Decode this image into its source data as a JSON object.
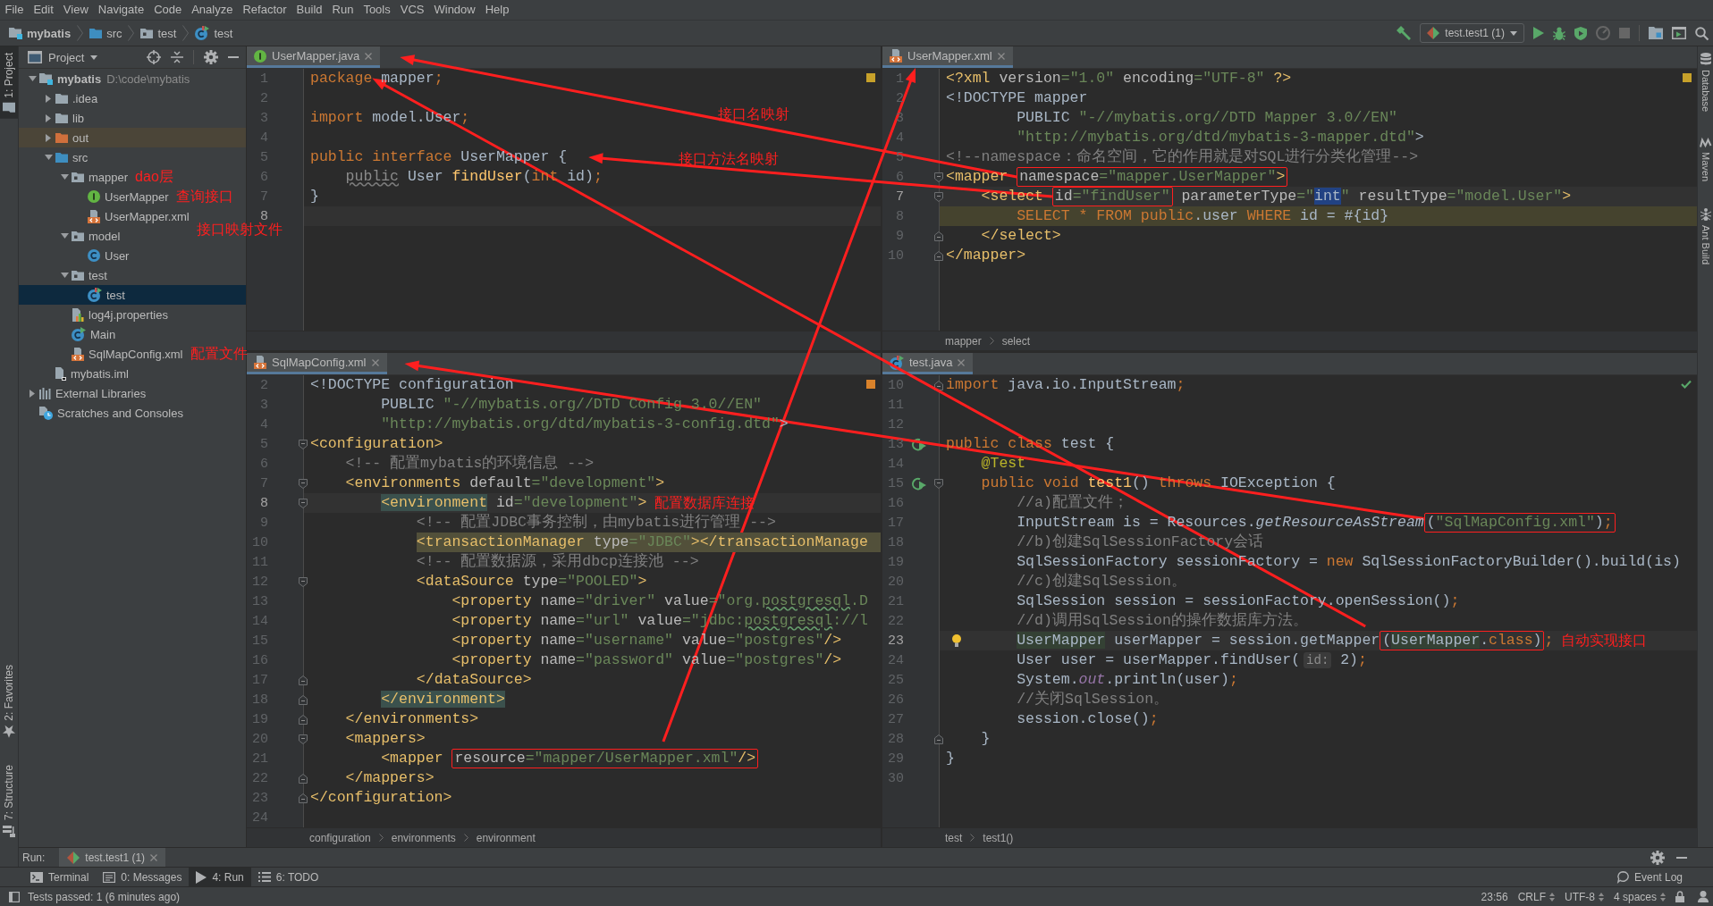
{
  "menu": [
    "File",
    "Edit",
    "View",
    "Navigate",
    "Code",
    "Analyze",
    "Refactor",
    "Build",
    "Run",
    "Tools",
    "VCS",
    "Window",
    "Help"
  ],
  "navigation": {
    "crumbs": [
      {
        "label": "mybatis",
        "kind": "module"
      },
      {
        "label": "src",
        "kind": "source-folder"
      },
      {
        "label": "test",
        "kind": "package"
      },
      {
        "label": "test",
        "kind": "test-class"
      }
    ],
    "toolbar": [
      {
        "kind": "build",
        "disabled": false
      },
      {
        "kind": "config",
        "label": "test.test1 (1)",
        "disabled": false
      },
      {
        "kind": "run",
        "disabled": false
      },
      {
        "kind": "debug",
        "disabled": false
      },
      {
        "kind": "coverage",
        "disabled": false
      },
      {
        "kind": "profile",
        "disabled": true
      },
      {
        "kind": "stop",
        "disabled": true
      },
      {
        "kind": "structure",
        "disabled": false
      },
      {
        "kind": "run-window",
        "disabled": false
      },
      {
        "kind": "search",
        "disabled": false
      }
    ]
  },
  "left_strip": {
    "top": [
      {
        "label": "1: Project",
        "kind": "project",
        "selected": true
      }
    ],
    "bottom": [
      {
        "label": "2: Favorites",
        "kind": "favorites",
        "selected": false
      },
      {
        "label": "7: Structure",
        "kind": "structure",
        "selected": false
      }
    ]
  },
  "project": {
    "title": "Project",
    "tree": [
      {
        "label": "mybatis",
        "path": "D:\\code\\mybatis",
        "kind": "module",
        "expanded": true,
        "selected": false,
        "children": [
          {
            "label": ".idea",
            "kind": "folder",
            "expanded": false,
            "selected": false
          },
          {
            "label": "lib",
            "kind": "folder",
            "expanded": false,
            "selected": false
          },
          {
            "label": "out",
            "kind": "excluded-folder",
            "expanded": false,
            "selected": false
          },
          {
            "label": "src",
            "kind": "source-folder",
            "expanded": true,
            "selected": false,
            "children": [
              {
                "label": "mapper",
                "kind": "package",
                "expanded": true,
                "selected": false,
                "note": "dao层",
                "children": [
                  {
                    "label": "UserMapper",
                    "kind": "interface",
                    "selected": false,
                    "note": "查询接口"
                  },
                  {
                    "label": "UserMapper.xml",
                    "kind": "xml",
                    "selected": false,
                    "note": "接口映射文件"
                  }
                ]
              },
              {
                "label": "model",
                "kind": "package",
                "expanded": true,
                "selected": false,
                "children": [
                  {
                    "label": "User",
                    "kind": "class",
                    "selected": false
                  }
                ]
              },
              {
                "label": "test",
                "kind": "package",
                "expanded": true,
                "selected": false,
                "children": [
                  {
                    "label": "test",
                    "kind": "test-class",
                    "selected": true
                  }
                ]
              },
              {
                "label": "log4j.properties",
                "kind": "properties",
                "selected": false
              },
              {
                "label": "Main",
                "kind": "main-class",
                "selected": false
              },
              {
                "label": "SqlMapConfig.xml",
                "kind": "xml",
                "selected": false,
                "note": "配置文件"
              }
            ]
          },
          {
            "label": "mybatis.iml",
            "kind": "iml",
            "selected": false
          }
        ]
      },
      {
        "label": "External Libraries",
        "kind": "libraries",
        "expanded": false,
        "selected": false
      },
      {
        "label": "Scratches and Consoles",
        "kind": "scratches",
        "selected": false
      }
    ]
  },
  "editors": [
    {
      "tab": {
        "label": "UserMapper.java",
        "kind": "interface",
        "selected": true
      },
      "inspection": {
        "kind": "warning"
      },
      "annotations": [
        "接口名映射",
        "接口方法名映射"
      ],
      "lines": [
        {
          "number": "1",
          "current": false,
          "tokens": [
            {
              "kind": "kw",
              "text": "package"
            },
            {
              "kind": "plain",
              "text": " mapper"
            },
            {
              "kind": "kw",
              "text": ";"
            }
          ]
        },
        {
          "number": "2",
          "current": false
        },
        {
          "number": "3",
          "current": false,
          "tokens": [
            {
              "kind": "kw",
              "text": "import"
            },
            {
              "kind": "plain",
              "text": " model.User"
            },
            {
              "kind": "kw",
              "text": ";"
            }
          ]
        },
        {
          "number": "4",
          "current": false
        },
        {
          "number": "5",
          "current": false,
          "tokens": [
            {
              "kind": "kw",
              "text": "public interface"
            },
            {
              "kind": "plain",
              "text": " UserMapper {"
            }
          ]
        },
        {
          "number": "6",
          "current": false,
          "tokens": [
            {
              "kind": "unused",
              "text": "    public"
            },
            {
              "kind": "plain",
              "text": " User "
            },
            {
              "kind": "method",
              "text": "findUser"
            },
            {
              "kind": "plain",
              "text": "("
            },
            {
              "kind": "kw",
              "text": "int"
            },
            {
              "kind": "plain",
              "text": " id)"
            },
            {
              "kind": "kw",
              "text": ";"
            }
          ]
        },
        {
          "number": "7",
          "current": false,
          "tokens": [
            {
              "kind": "plain",
              "text": "}"
            }
          ]
        },
        {
          "number": "8",
          "current": true
        }
      ]
    },
    {
      "tab": {
        "label": "UserMapper.xml",
        "kind": "xml",
        "selected": true
      },
      "inspection": {
        "kind": "warning"
      },
      "breadcrumbs": [
        "mapper",
        "select"
      ],
      "lines": [
        {
          "number": "1",
          "current": false,
          "injected": false,
          "tokens": [
            {
              "kind": "tag",
              "text": "<?xml"
            },
            {
              "kind": "attr",
              "text": " version"
            },
            {
              "kind": "string",
              "text": "=\"1.0\""
            },
            {
              "kind": "attr",
              "text": " encoding"
            },
            {
              "kind": "string",
              "text": "=\"UTF-8\""
            },
            {
              "kind": "tag",
              "text": " ?>"
            }
          ]
        },
        {
          "number": "2",
          "current": false,
          "injected": false,
          "tokens": [
            {
              "kind": "plain",
              "text": "<!DOCTYPE mapper"
            }
          ]
        },
        {
          "number": "3",
          "current": false,
          "injected": false,
          "tokens": [
            {
              "kind": "plain",
              "text": "        PUBLIC "
            },
            {
              "kind": "string",
              "text": "\"-//mybatis.org//DTD Mapper 3.0//EN\""
            }
          ]
        },
        {
          "number": "4",
          "current": false,
          "injected": false,
          "tokens": [
            {
              "kind": "string",
              "text": "        \"http://mybatis.org/dtd/mybatis-3-mapper.dtd\""
            },
            {
              "kind": "plain",
              "text": ">"
            }
          ]
        },
        {
          "number": "5",
          "current": false,
          "injected": false,
          "tokens": [
            {
              "kind": "comment",
              "text": "<!--namespace：命名空间，它的作用就是对SQL进行分类化管理-->"
            }
          ]
        },
        {
          "number": "6",
          "current": false,
          "injected": false,
          "markers": [
            {
              "kind": "fold"
            }
          ],
          "tokens": [
            {
              "kind": "tag",
              "text": "<mapper "
            },
            {
              "kind": "frame",
              "tokens": [
                {
                  "kind": "attr",
                  "text": "namespace"
                },
                {
                  "kind": "string",
                  "text": "=\"mapper.UserMapper\""
                },
                {
                  "kind": "tag",
                  "text": ">"
                }
              ]
            }
          ]
        },
        {
          "number": "7",
          "current": true,
          "injected": false,
          "markers": [
            {
              "kind": "fold"
            }
          ],
          "tokens": [
            {
              "kind": "tag",
              "text": "    <select "
            },
            {
              "kind": "frame",
              "tokens": [
                {
                  "kind": "attr",
                  "text": "id"
                },
                {
                  "kind": "string",
                  "text": "=\"findUser\""
                }
              ]
            },
            {
              "kind": "attr",
              "text": " parameterType"
            },
            {
              "kind": "string",
              "text": "=\""
            },
            {
              "kind": "selection",
              "text": "int"
            },
            {
              "kind": "string",
              "text": "\""
            },
            {
              "kind": "attr",
              "text": " resultType"
            },
            {
              "kind": "string",
              "text": "=\"model.User\""
            },
            {
              "kind": "tag",
              "text": ">"
            }
          ]
        },
        {
          "number": "8",
          "current": false,
          "injected": true,
          "tokens": [
            {
              "kind": "kw",
              "text": "        SELECT * FROM public"
            },
            {
              "kind": "plain",
              "text": ".user "
            },
            {
              "kind": "kw",
              "text": "WHERE"
            },
            {
              "kind": "plain",
              "text": " id = #{id}"
            }
          ]
        },
        {
          "number": "9",
          "current": false,
          "injected": false,
          "markers": [
            {
              "kind": "fold-end"
            }
          ],
          "tokens": [
            {
              "kind": "tag",
              "text": "    </select>"
            }
          ]
        },
        {
          "number": "10",
          "current": false,
          "injected": false,
          "markers": [
            {
              "kind": "fold-end"
            }
          ],
          "tokens": [
            {
              "kind": "tag",
              "text": "</mapper>"
            }
          ]
        }
      ]
    },
    {
      "tab": {
        "label": "SqlMapConfig.xml",
        "kind": "xml",
        "selected": true
      },
      "inspection": {
        "kind": "problem"
      },
      "breadcrumbs": [
        "configuration",
        "environments",
        "environment"
      ],
      "lines": [
        {
          "number": "2",
          "current": false,
          "warning": false,
          "tokens": [
            {
              "kind": "plain",
              "text": "<!DOCTYPE configuration"
            }
          ]
        },
        {
          "number": "3",
          "current": false,
          "warning": false,
          "tokens": [
            {
              "kind": "plain",
              "text": "        PUBLIC "
            },
            {
              "kind": "string",
              "text": "\"-//mybatis.org//DTD Config 3.0//EN\""
            }
          ]
        },
        {
          "number": "4",
          "current": false,
          "warning": false,
          "tokens": [
            {
              "kind": "string",
              "text": "        \"http://mybatis.org/dtd/mybatis-3-config.dtd\""
            },
            {
              "kind": "plain",
              "text": ">"
            }
          ]
        },
        {
          "number": "5",
          "current": false,
          "warning": false,
          "markers": [
            {
              "kind": "fold"
            }
          ],
          "tokens": [
            {
              "kind": "tag",
              "text": "<configuration>"
            }
          ]
        },
        {
          "number": "6",
          "current": false,
          "warning": false,
          "tokens": [
            {
              "kind": "comment",
              "text": "    <!-- 配置mybatis的环境信息 -->"
            }
          ]
        },
        {
          "number": "7",
          "current": false,
          "warning": false,
          "markers": [
            {
              "kind": "fold"
            }
          ],
          "tokens": [
            {
              "kind": "tag",
              "text": "    <environments"
            },
            {
              "kind": "attr",
              "text": " default"
            },
            {
              "kind": "string",
              "text": "=\"development\""
            },
            {
              "kind": "tag",
              "text": ">"
            }
          ]
        },
        {
          "number": "8",
          "current": true,
          "warning": false,
          "markers": [
            {
              "kind": "fold"
            }
          ],
          "note": "配置数据库连接",
          "tokens": [
            {
              "kind": "match",
              "text": "        <environment"
            },
            {
              "kind": "attr",
              "text": " id"
            },
            {
              "kind": "string",
              "text": "=\"development\""
            },
            {
              "kind": "tag",
              "text": ">"
            }
          ]
        },
        {
          "number": "9",
          "current": false,
          "warning": false,
          "tokens": [
            {
              "kind": "comment",
              "text": "            <!-- 配置JDBC事务控制，由mybatis进行管理 -->"
            }
          ]
        },
        {
          "number": "10",
          "current": false,
          "warning": true,
          "tokens": [
            {
              "kind": "tag",
              "text": "            <transactionManager"
            },
            {
              "kind": "attr",
              "text": " type"
            },
            {
              "kind": "string",
              "text": "=\"JDBC\""
            },
            {
              "kind": "tag",
              "text": "></transactionManage"
            }
          ]
        },
        {
          "number": "11",
          "current": false,
          "warning": false,
          "tokens": [
            {
              "kind": "comment",
              "text": "            <!-- 配置数据源，采用dbcp连接池 -->"
            }
          ]
        },
        {
          "number": "12",
          "current": false,
          "warning": false,
          "markers": [
            {
              "kind": "fold"
            }
          ],
          "tokens": [
            {
              "kind": "tag",
              "text": "            <dataSource"
            },
            {
              "kind": "attr",
              "text": " type"
            },
            {
              "kind": "string",
              "text": "=\"POOLED\""
            },
            {
              "kind": "tag",
              "text": ">"
            }
          ]
        },
        {
          "number": "13",
          "current": false,
          "warning": false,
          "tokens": [
            {
              "kind": "tag",
              "text": "                <property"
            },
            {
              "kind": "attr",
              "text": " name"
            },
            {
              "kind": "string",
              "text": "=\"driver\""
            },
            {
              "kind": "attr",
              "text": " value"
            },
            {
              "kind": "string",
              "text": "=\"org."
            },
            {
              "kind": "typo",
              "text": "postgresql"
            },
            {
              "kind": "string",
              "text": ".D"
            }
          ]
        },
        {
          "number": "14",
          "current": false,
          "warning": false,
          "tokens": [
            {
              "kind": "tag",
              "text": "                <property"
            },
            {
              "kind": "attr",
              "text": " name"
            },
            {
              "kind": "string",
              "text": "=\"url\""
            },
            {
              "kind": "attr",
              "text": " value"
            },
            {
              "kind": "string",
              "text": "=\"jdbc:"
            },
            {
              "kind": "typo",
              "text": "postgresql"
            },
            {
              "kind": "string",
              "text": "://l"
            }
          ]
        },
        {
          "number": "15",
          "current": false,
          "warning": false,
          "tokens": [
            {
              "kind": "tag",
              "text": "                <property"
            },
            {
              "kind": "attr",
              "text": " name"
            },
            {
              "kind": "string",
              "text": "=\"username\""
            },
            {
              "kind": "attr",
              "text": " value"
            },
            {
              "kind": "string",
              "text": "=\"postgres\""
            },
            {
              "kind": "tag",
              "text": "/>"
            }
          ]
        },
        {
          "number": "16",
          "current": false,
          "warning": false,
          "tokens": [
            {
              "kind": "tag",
              "text": "                <property"
            },
            {
              "kind": "attr",
              "text": " name"
            },
            {
              "kind": "string",
              "text": "=\"password\""
            },
            {
              "kind": "attr",
              "text": " value"
            },
            {
              "kind": "string",
              "text": "=\"postgres\""
            },
            {
              "kind": "tag",
              "text": "/>"
            }
          ]
        },
        {
          "number": "17",
          "current": false,
          "warning": false,
          "markers": [
            {
              "kind": "fold-end"
            }
          ],
          "tokens": [
            {
              "kind": "tag",
              "text": "            </dataSource>"
            }
          ]
        },
        {
          "number": "18",
          "current": false,
          "warning": false,
          "markers": [
            {
              "kind": "fold-end"
            }
          ],
          "tokens": [
            {
              "kind": "match",
              "text": "        </environment>"
            }
          ]
        },
        {
          "number": "19",
          "current": false,
          "warning": false,
          "markers": [
            {
              "kind": "fold-end"
            }
          ],
          "tokens": [
            {
              "kind": "tag",
              "text": "    </environments>"
            }
          ]
        },
        {
          "number": "20",
          "current": false,
          "warning": false,
          "markers": [
            {
              "kind": "fold"
            }
          ],
          "tokens": [
            {
              "kind": "tag",
              "text": "    <mappers>"
            }
          ]
        },
        {
          "number": "21",
          "current": false,
          "warning": false,
          "tokens": [
            {
              "kind": "tag",
              "text": "        <mapper "
            },
            {
              "kind": "frame",
              "tokens": [
                {
                  "kind": "attr",
                  "text": "resource"
                },
                {
                  "kind": "string",
                  "text": "=\"mapper/UserMapper.xml\""
                },
                {
                  "kind": "tag",
                  "text": "/>"
                }
              ]
            }
          ]
        },
        {
          "number": "22",
          "current": false,
          "warning": false,
          "markers": [
            {
              "kind": "fold-end"
            }
          ],
          "tokens": [
            {
              "kind": "tag",
              "text": "    </mappers>"
            }
          ]
        },
        {
          "number": "23",
          "current": false,
          "warning": false,
          "markers": [
            {
              "kind": "fold-end"
            }
          ],
          "tokens": [
            {
              "kind": "tag",
              "text": "</configuration>"
            }
          ]
        },
        {
          "number": "24",
          "current": false,
          "warning": false
        }
      ]
    },
    {
      "tab": {
        "label": "test.java",
        "kind": "test-class",
        "selected": true
      },
      "inspection": {
        "kind": "ok"
      },
      "breadcrumbs": [
        "test",
        "test1()"
      ],
      "lines": [
        {
          "number": "10",
          "current": false,
          "markers": [
            {
              "kind": "fold-end"
            }
          ],
          "tokens": [
            {
              "kind": "kw",
              "text": "import"
            },
            {
              "kind": "plain",
              "text": " java.io.InputStream"
            },
            {
              "kind": "kw",
              "text": ";"
            }
          ]
        },
        {
          "number": "11",
          "current": false
        },
        {
          "number": "12",
          "current": false
        },
        {
          "number": "13",
          "current": false,
          "markers": [
            {
              "kind": "run"
            }
          ],
          "tokens": [
            {
              "kind": "kw",
              "text": "public class"
            },
            {
              "kind": "plain",
              "text": " test {"
            }
          ]
        },
        {
          "number": "14",
          "current": false,
          "tokens": [
            {
              "kind": "annotation",
              "text": "    @Test"
            }
          ]
        },
        {
          "number": "15",
          "current": false,
          "markers": [
            {
              "kind": "run"
            },
            {
              "kind": "fold"
            }
          ],
          "tokens": [
            {
              "kind": "kw",
              "text": "    public void "
            },
            {
              "kind": "method",
              "text": "test1"
            },
            {
              "kind": "plain",
              "text": "() "
            },
            {
              "kind": "kw",
              "text": "throws"
            },
            {
              "kind": "plain",
              "text": " IOException {"
            }
          ]
        },
        {
          "number": "16",
          "current": false,
          "tokens": [
            {
              "kind": "comment",
              "text": "        //a)配置文件；"
            }
          ]
        },
        {
          "number": "17",
          "current": false,
          "tokens": [
            {
              "kind": "plain",
              "text": "        InputStream is = Resources."
            },
            {
              "kind": "italic",
              "text": "getResourceAsStream"
            },
            {
              "kind": "frame",
              "tokens": [
                {
                  "kind": "plain",
                  "text": "("
                },
                {
                  "kind": "string",
                  "text": "\"SqlMapConfig.xml\""
                },
                {
                  "kind": "plain",
                  "text": ")"
                },
                {
                  "kind": "kw",
                  "text": ";"
                }
              ]
            }
          ]
        },
        {
          "number": "18",
          "current": false,
          "tokens": [
            {
              "kind": "comment",
              "text": "        //b)创建SqlSessionFactory会话"
            }
          ]
        },
        {
          "number": "19",
          "current": false,
          "tokens": [
            {
              "kind": "plain",
              "text": "        SqlSessionFactory sessionFactory = "
            },
            {
              "kind": "kw",
              "text": "new"
            },
            {
              "kind": "plain",
              "text": " SqlSessionFactoryBuilder().build(is)"
            }
          ]
        },
        {
          "number": "20",
          "current": false,
          "tokens": [
            {
              "kind": "comment",
              "text": "        //c)创建SqlSession。"
            }
          ]
        },
        {
          "number": "21",
          "current": false,
          "tokens": [
            {
              "kind": "plain",
              "text": "        SqlSession session = sessionFactory.openSession()"
            },
            {
              "kind": "kw",
              "text": ";"
            }
          ]
        },
        {
          "number": "22",
          "current": false,
          "tokens": [
            {
              "kind": "comment",
              "text": "        //d)调用SqlSession的操作数据库方法。"
            }
          ]
        },
        {
          "number": "23",
          "current": true,
          "markers": [
            {
              "kind": "bulb"
            }
          ],
          "note": "自动实现接口",
          "tokens": [
            {
              "kind": "usage",
              "text": "        UserMapper"
            },
            {
              "kind": "plain",
              "text": " userMapper = session.getMapper"
            },
            {
              "kind": "frame",
              "tokens": [
                {
                  "kind": "plain",
                  "text": "("
                },
                {
                  "kind": "usage",
                  "text": "UserMapper"
                },
                {
                  "kind": "plain",
                  "text": "."
                },
                {
                  "kind": "kw",
                  "text": "class"
                },
                {
                  "kind": "plain",
                  "text": ")"
                }
              ]
            },
            {
              "kind": "kw",
              "text": ";"
            }
          ]
        },
        {
          "number": "24",
          "current": false,
          "tokens": [
            {
              "kind": "plain",
              "text": "        User user = userMapper.findUser("
            },
            {
              "kind": "hint",
              "text": "id:"
            },
            {
              "kind": "plain",
              "text": " 2)"
            },
            {
              "kind": "kw",
              "text": ";"
            }
          ]
        },
        {
          "number": "25",
          "current": false,
          "tokens": [
            {
              "kind": "plain",
              "text": "        System."
            },
            {
              "kind": "static",
              "text": "out"
            },
            {
              "kind": "plain",
              "text": ".println(user)"
            },
            {
              "kind": "kw",
              "text": ";"
            }
          ]
        },
        {
          "number": "26",
          "current": false,
          "tokens": [
            {
              "kind": "comment",
              "text": "        //关闭SqlSession。"
            }
          ]
        },
        {
          "number": "27",
          "current": false,
          "tokens": [
            {
              "kind": "plain",
              "text": "        session.close()"
            },
            {
              "kind": "kw",
              "text": ";"
            }
          ]
        },
        {
          "number": "28",
          "current": false,
          "markers": [
            {
              "kind": "fold-end"
            }
          ],
          "tokens": [
            {
              "kind": "plain",
              "text": "    }"
            }
          ]
        },
        {
          "number": "29",
          "current": false,
          "tokens": [
            {
              "kind": "plain",
              "text": "}"
            }
          ]
        },
        {
          "number": "30",
          "current": false
        }
      ]
    }
  ],
  "right_strip": [
    {
      "label": "Database",
      "kind": "database"
    },
    {
      "label": "Maven",
      "kind": "maven"
    },
    {
      "label": "Ant Build",
      "kind": "ant"
    }
  ],
  "run_window": {
    "label": "Run:",
    "tab": {
      "label": "test.test1 (1)",
      "selected": true
    }
  },
  "tool_windows": {
    "buttons": [
      {
        "label": "Terminal",
        "kind": "terminal",
        "selected": false
      },
      {
        "label": "0: Messages",
        "kind": "messages",
        "selected": false
      },
      {
        "label": "4: Run",
        "kind": "run",
        "selected": true
      },
      {
        "label": "6: TODO",
        "kind": "todo",
        "selected": false
      }
    ],
    "event_log": "Event Log"
  },
  "status_bar": {
    "message": "Tests passed: 1 (6 minutes ago)",
    "items": [
      {
        "label": "23:56",
        "kind": "position"
      },
      {
        "label": "CRLF",
        "kind": "dropdown"
      },
      {
        "label": "UTF-8",
        "kind": "dropdown"
      },
      {
        "label": "4 spaces",
        "kind": "dropdown"
      }
    ]
  }
}
